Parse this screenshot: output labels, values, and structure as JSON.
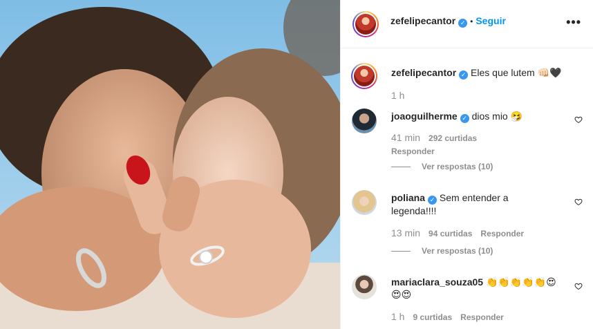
{
  "post": {
    "author": "zefelipecantor",
    "follow_label": "Seguir",
    "dot": "•",
    "more_label": "•••",
    "verified_mark": "✓"
  },
  "caption": {
    "username": "zefelipecantor",
    "text": "Eles que lutem 👊🏻🖤",
    "time": "1 h"
  },
  "comments": [
    {
      "username": "joaoguilherme",
      "text": "dios mio 🤧",
      "time": "41 min",
      "likes": "292 curtidas",
      "reply_label": "Responder",
      "view_replies": "Ver respostas (10)"
    },
    {
      "username": "poliana",
      "text": "Sem entender a legenda!!!!",
      "time": "13 min",
      "likes": "94 curtidas",
      "reply_label": "Responder",
      "view_replies": "Ver respostas (10)"
    },
    {
      "username": "mariaclara_souza05",
      "text": "👏👏👏👏👏😍😍😍",
      "time": "1 h",
      "likes": "9 curtidas",
      "reply_label": "Responder"
    }
  ],
  "colors": {
    "link": "#0095f6",
    "verified": "#3897f0",
    "muted": "#8e8e8e"
  }
}
